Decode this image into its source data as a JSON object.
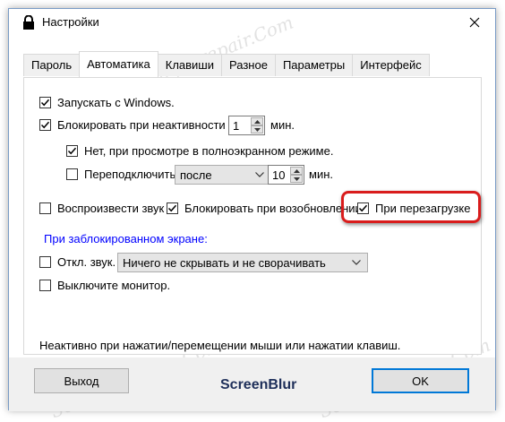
{
  "window": {
    "title": "Настройки",
    "close_symbol": "×"
  },
  "tabs": [
    {
      "label": "Пароль",
      "active": false
    },
    {
      "label": "Автоматика",
      "active": true
    },
    {
      "label": "Клавиши",
      "active": false
    },
    {
      "label": "Разное",
      "active": false
    },
    {
      "label": "Параметры",
      "active": false
    },
    {
      "label": "Интерфейс",
      "active": false
    }
  ],
  "automation": {
    "start_with_windows": {
      "label": "Запускать с Windows.",
      "checked": true
    },
    "lock_idle": {
      "label": "Блокировать при неактивности ПК",
      "checked": true,
      "minutes": "1",
      "unit": "мин."
    },
    "not_fullscreen": {
      "label": "Нет, при просмотре в полноэкранном режиме.",
      "checked": true
    },
    "reconnect": {
      "label": "Переподключить",
      "checked": false,
      "mode": "после",
      "minutes": "10",
      "unit": "мин."
    },
    "play_sound": {
      "label": "Воспроизвести звук",
      "checked": false
    },
    "lock_on_resume": {
      "label": "Блокировать при возобновлении",
      "checked": true
    },
    "on_reboot": {
      "label": "При перезагрузке",
      "checked": true
    }
  },
  "locked_screen": {
    "heading": "При заблокированном экране:",
    "mute": {
      "label": "Откл. звук.",
      "checked": false
    },
    "hide_mode": "Ничего не скрывать и не сворачивать",
    "monitor_off": {
      "label": "Выключите монитор.",
      "checked": false
    }
  },
  "hint": "Неактивно при нажатии/перемещении мыши или нажатии клавиш.",
  "footer": {
    "exit_label": "Выход",
    "brand": "ScreenBlur",
    "ok_label": "OK"
  },
  "watermark": "Soringpcrepair.Com",
  "colors": {
    "highlight": "#d91c1c",
    "link_blue": "#0000ff",
    "default_button_border": "#0078d7"
  }
}
